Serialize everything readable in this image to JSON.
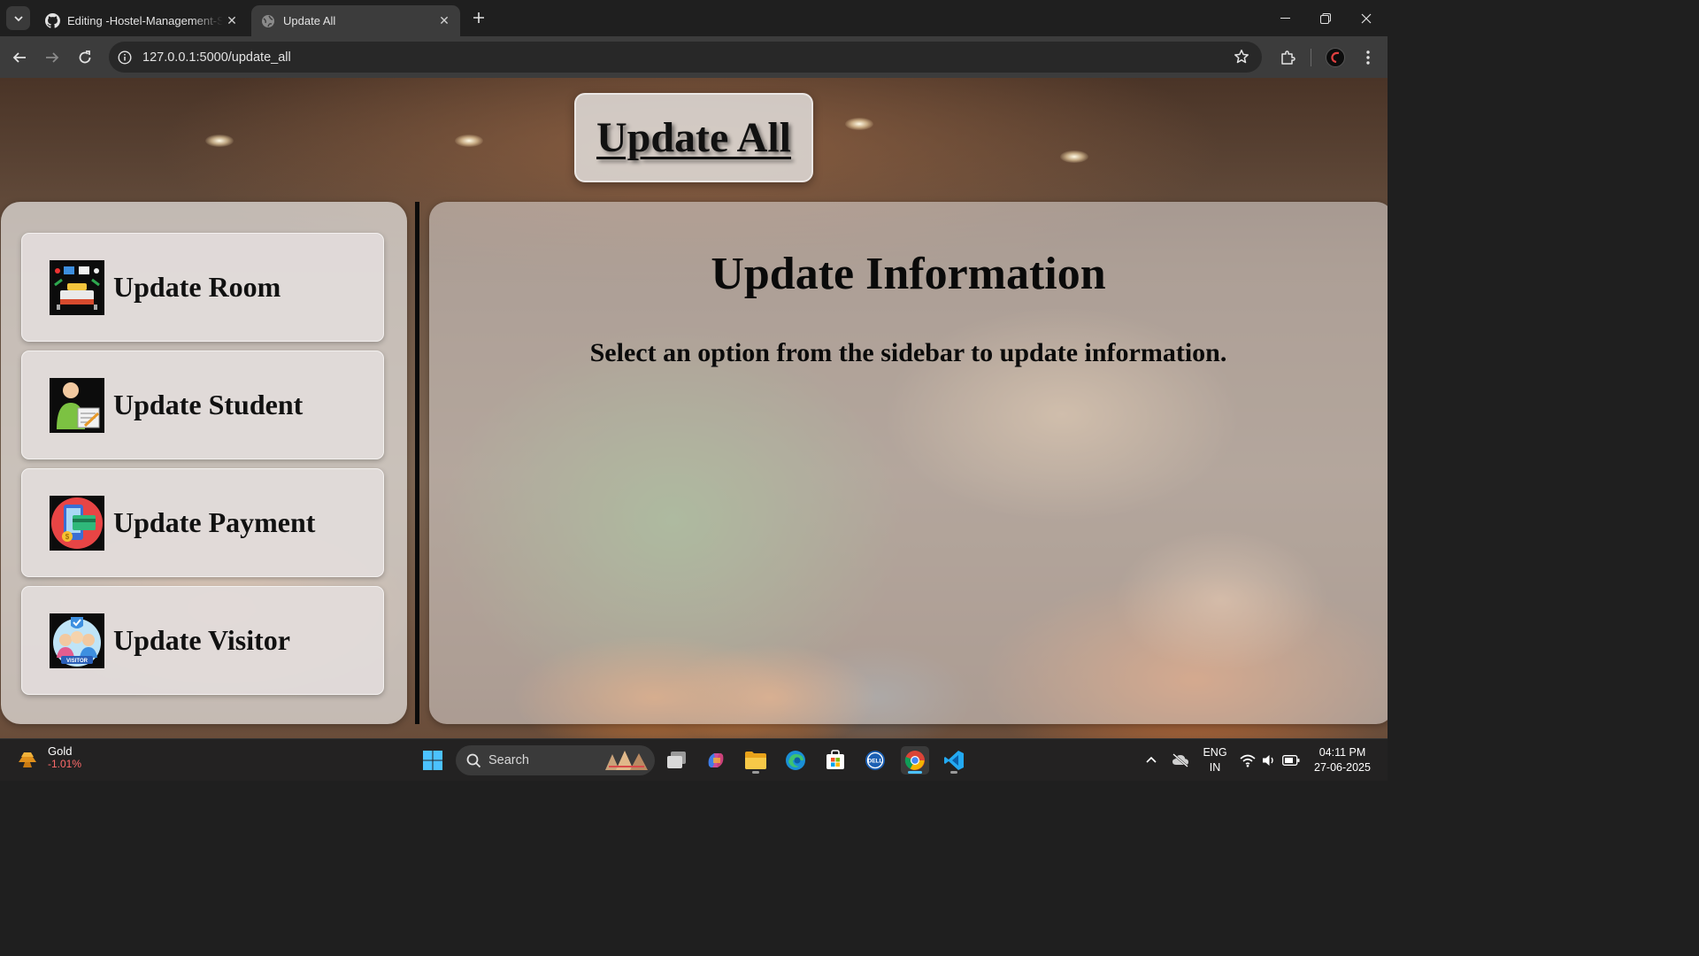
{
  "browser": {
    "tabs": [
      {
        "title": "Editing -Hostel-Management-S",
        "active": false,
        "favicon": "github-icon"
      },
      {
        "title": "Update All",
        "active": true,
        "favicon": "globe-icon"
      }
    ],
    "url": "127.0.0.1:5000/update_all"
  },
  "page": {
    "header_title": "Update All",
    "sidebar": {
      "items": [
        {
          "label": "Update Room",
          "icon": "room-icon"
        },
        {
          "label": "Update Student",
          "icon": "student-icon"
        },
        {
          "label": "Update Payment",
          "icon": "payment-icon"
        },
        {
          "label": "Update Visitor",
          "icon": "visitor-icon"
        }
      ]
    },
    "main": {
      "heading": "Update Information",
      "message": "Select an option from the sidebar to update information."
    }
  },
  "taskbar": {
    "widget": {
      "name": "Gold",
      "value": "-1.01%",
      "value_color": "#ff6b6b"
    },
    "search_placeholder": "Search",
    "tray": {
      "lang_line1": "ENG",
      "lang_line2": "IN",
      "time": "04:11 PM",
      "date": "27-06-2025"
    }
  },
  "colors": {
    "accent": "#4cc2ff",
    "panel_text": "#0a0a0a"
  }
}
